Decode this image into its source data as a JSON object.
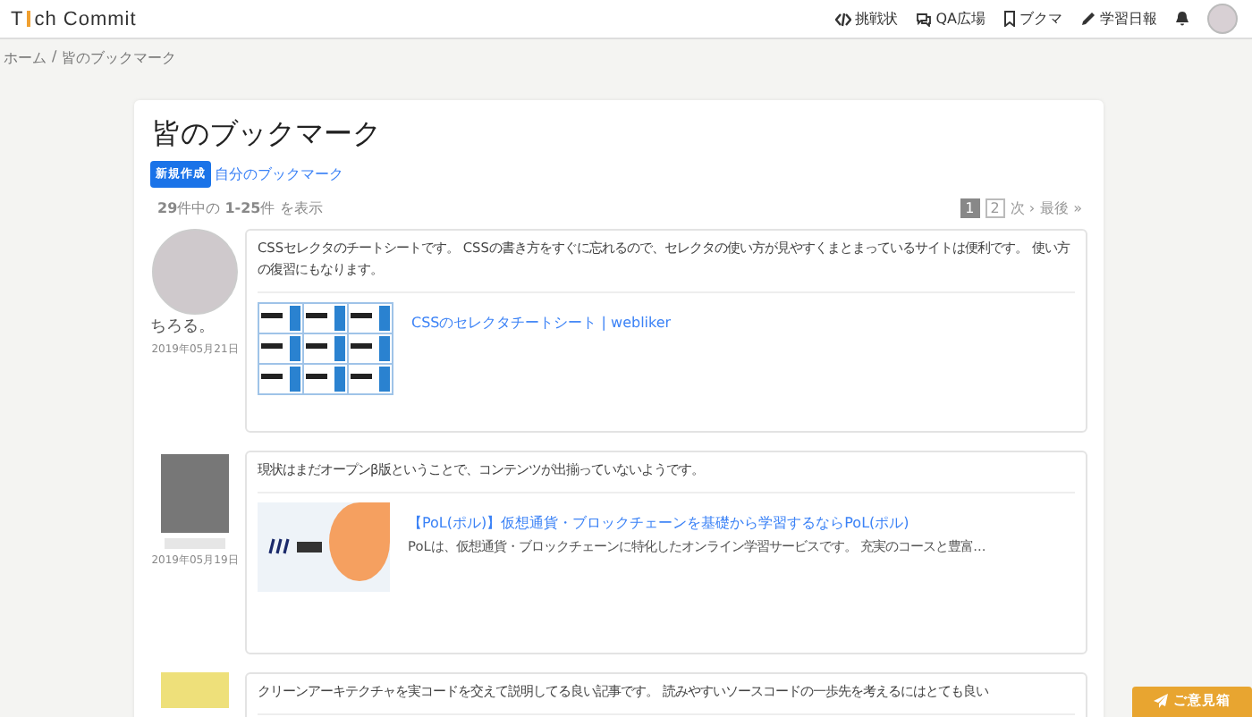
{
  "header": {
    "logo": [
      "T",
      "ch Commit"
    ],
    "nav": [
      {
        "kind": "code",
        "label": "挑戦状"
      },
      {
        "kind": "chat",
        "label": "QA広場"
      },
      {
        "kind": "bookmark",
        "label": "ブクマ"
      },
      {
        "kind": "pencil",
        "label": "学習日報"
      },
      {
        "kind": "bell"
      }
    ]
  },
  "breadcrumb": {
    "items": [
      "ホーム",
      "皆のブックマーク"
    ],
    "separator": "/"
  },
  "title": "皆のブックマーク",
  "new_button": "新規作成",
  "my_link": "自分のブックマーク",
  "summary": "**29**件中の **1-25**件 を表示",
  "pagination": {
    "pages": [
      {
        "label": "1",
        "selected": true
      },
      {
        "label": "2",
        "selected": false
      }
    ],
    "next": "次 ›",
    "last": "最後 »"
  },
  "posts": [
    {
      "kind": "named",
      "user": "ちろる。",
      "date": "2019年05月21日",
      "comment": "CSSセレクタのチートシートです。 CSSの書き方をすぐに忘れるので、セレクタの使い方が見やすくまとまっているサイトは便利です。 使い方の復習にもなります。",
      "link": {
        "kind": "sheet",
        "title": "CSSのセレクタチートシート | webliker"
      }
    },
    {
      "kind": "blurred",
      "date": "2019年05月19日",
      "comment": "現状はまだオープンβ版ということで、コンテンツが出揃っていないようです。",
      "link": {
        "kind": "logo",
        "title": "【PoL(ポル)】仮想通貨・ブロックチェーンを基礎から学習するならPoL(ポル)",
        "description": "PoLは、仮想通貨・ブロックチェーンに特化したオンライン学習サービスです。 充実のコースと豊富..."
      }
    },
    {
      "kind": "partial",
      "comment": "クリーンアーキテクチャを実コードを交えて説明してる良い記事です。 読みやすいソースコードの一歩先を考えるにはとても良い"
    }
  ],
  "feedback_button": "ご意見箱"
}
